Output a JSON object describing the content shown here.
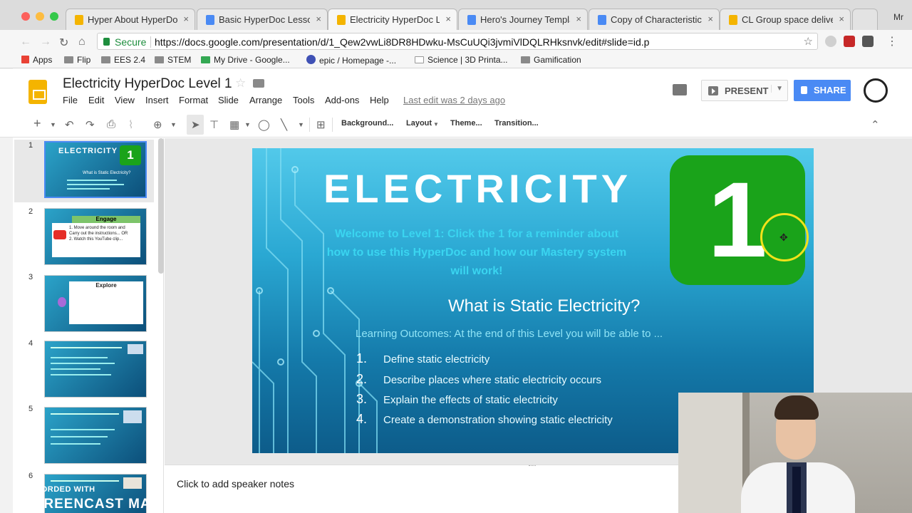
{
  "colors": {
    "accent": "#4a8af4",
    "slide_green": "#1aa31a",
    "secure_green": "#1e8e3e"
  },
  "browser": {
    "tabs": [
      {
        "label": "Hyper About HyperDoc",
        "icon": "slides-icon"
      },
      {
        "label": "Basic HyperDoc Lesson",
        "icon": "docs-icon"
      },
      {
        "label": "Electricity HyperDoc Le",
        "icon": "slides-icon"
      },
      {
        "label": "Hero's Journey Templat",
        "icon": "docs-icon"
      },
      {
        "label": "Copy of Characteristics",
        "icon": "docs-icon"
      },
      {
        "label": "CL Group space deliver",
        "icon": "slides-icon"
      }
    ],
    "tab_close": "×",
    "profile": "Mr",
    "secure_label": "Secure",
    "url": "https://docs.google.com/presentation/d/1_Qew2vwLi8DR8HDwku-MsCuUQi3jvmiVlDQLRHksnvk/edit#slide=id.p",
    "bookmarks": [
      "Apps",
      "Flip",
      "EES 2.4",
      "STEM",
      "My Drive - Google...",
      "epic / Homepage -...",
      "Science | 3D Printa...",
      "Gamification"
    ]
  },
  "app": {
    "title": "Electricity HyperDoc Level 1",
    "menu": [
      "File",
      "Edit",
      "View",
      "Insert",
      "Format",
      "Slide",
      "Arrange",
      "Tools",
      "Add-ons",
      "Help"
    ],
    "last_edit": "Last edit was 2 days ago",
    "present_label": "PRESENT",
    "share_label": "SHARE"
  },
  "toolbar": {
    "background": "Background...",
    "layout": "Layout",
    "theme": "Theme...",
    "transition": "Transition..."
  },
  "filmstrip": {
    "numbers": [
      "1",
      "2",
      "3",
      "4",
      "5",
      "6"
    ],
    "thumb1": {
      "title": "ELECTRICITY",
      "badge": "1",
      "subtitle": "What is Static Electricity?"
    },
    "thumb2": {
      "title": "Engage",
      "line1": "1. Move around the room and",
      "line2": "Carry out the instructions... OR",
      "line3": "2. Watch this YouTube clip..."
    },
    "thumb3": {
      "title": "Explore"
    }
  },
  "slide": {
    "title": "ELECTRICITY",
    "welcome_l1": "Welcome to Level 1: Click the 1 for a reminder about",
    "welcome_l2": "how to use this HyperDoc and how our Mastery system",
    "welcome_l3": "will work!",
    "badge": "1",
    "question": "What is Static Electricity?",
    "outcomes": "Learning Outcomes: At the end of this Level you will be able to ...",
    "list": [
      {
        "n": "1.",
        "t": "Define static electricity"
      },
      {
        "n": "2.",
        "t": "Describe places where static electricity occurs"
      },
      {
        "n": "3.",
        "t": "Explain the effects of static electricity"
      },
      {
        "n": "4.",
        "t": "Create a demonstration showing static electricity"
      }
    ]
  },
  "notes": {
    "placeholder": "Click to add speaker notes"
  },
  "watermark": {
    "line1": "RECORDED WITH",
    "line2": "SCREENCAST  MATIC"
  }
}
